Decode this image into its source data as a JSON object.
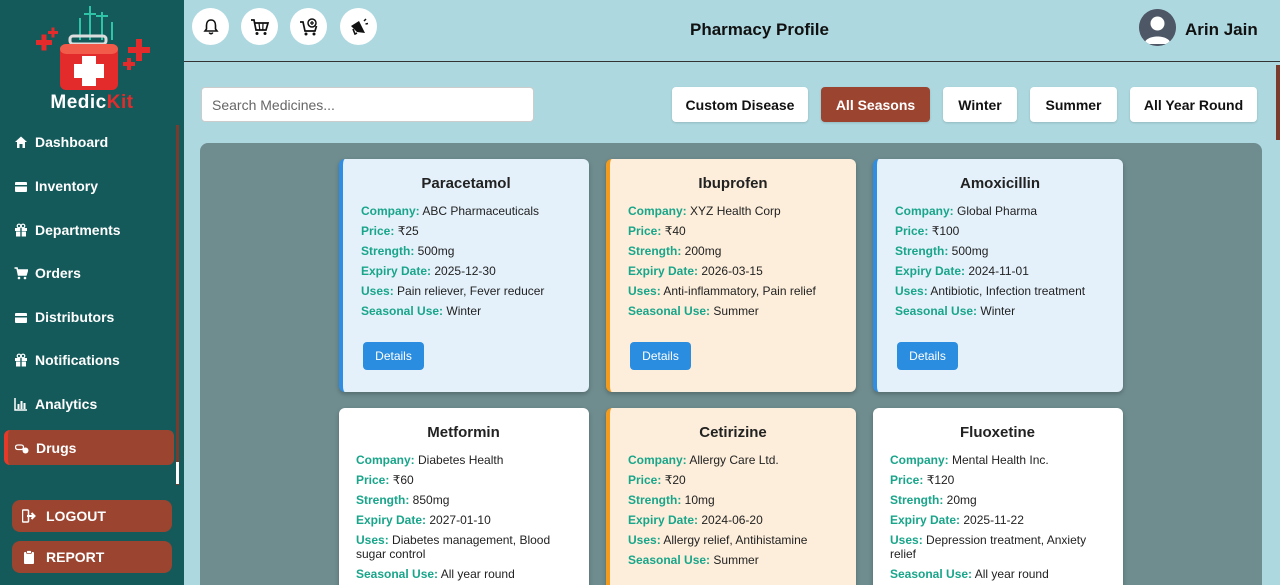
{
  "brand": {
    "name_part1": "Medic",
    "name_part2": "Kit"
  },
  "sidebar": {
    "items": [
      {
        "label": "Dashboard",
        "icon": "home-icon"
      },
      {
        "label": "Inventory",
        "icon": "box-icon"
      },
      {
        "label": "Departments",
        "icon": "gift-icon"
      },
      {
        "label": "Orders",
        "icon": "cart-icon"
      },
      {
        "label": "Distributors",
        "icon": "box-icon"
      },
      {
        "label": "Notifications",
        "icon": "gift-icon"
      },
      {
        "label": "Analytics",
        "icon": "chart-icon"
      },
      {
        "label": "Drugs",
        "icon": "pills-icon",
        "active": true
      }
    ],
    "logout_label": "LOGOUT",
    "report_label": "REPORT"
  },
  "header": {
    "title": "Pharmacy Profile",
    "user_name": "Arin Jain",
    "icons": [
      "bell-icon",
      "cart-icon",
      "cart-add-icon",
      "megaphone-icon"
    ]
  },
  "search": {
    "placeholder": "Search Medicines...",
    "value": ""
  },
  "filters": [
    {
      "label": "Custom Disease"
    },
    {
      "label": "All Seasons",
      "active": true
    },
    {
      "label": "Winter"
    },
    {
      "label": "Summer"
    },
    {
      "label": "All Year Round"
    }
  ],
  "field_labels": {
    "company": "Company:",
    "price": "Price:",
    "strength": "Strength:",
    "expiry": "Expiry Date:",
    "uses": "Uses:",
    "seasonal": "Seasonal Use:"
  },
  "details_label": "Details",
  "medicines": [
    {
      "name": "Paracetamol",
      "company": "ABC Pharmaceuticals",
      "price": "₹25",
      "strength": "500mg",
      "expiry": "2025-12-30",
      "uses": "Pain reliever, Fever reducer",
      "seasonal": "Winter"
    },
    {
      "name": "Ibuprofen",
      "company": "XYZ Health Corp",
      "price": "₹40",
      "strength": "200mg",
      "expiry": "2026-03-15",
      "uses": "Anti-inflammatory, Pain relief",
      "seasonal": "Summer"
    },
    {
      "name": "Amoxicillin",
      "company": "Global Pharma",
      "price": "₹100",
      "strength": "500mg",
      "expiry": "2024-11-01",
      "uses": "Antibiotic, Infection treatment",
      "seasonal": "Winter"
    },
    {
      "name": "Metformin",
      "company": "Diabetes Health",
      "price": "₹60",
      "strength": "850mg",
      "expiry": "2027-01-10",
      "uses": "Diabetes management, Blood sugar control",
      "seasonal": "All year round"
    },
    {
      "name": "Cetirizine",
      "company": "Allergy Care Ltd.",
      "price": "₹20",
      "strength": "10mg",
      "expiry": "2024-06-20",
      "uses": "Allergy relief, Antihistamine",
      "seasonal": "Summer"
    },
    {
      "name": "Fluoxetine",
      "company": "Mental Health Inc.",
      "price": "₹120",
      "strength": "20mg",
      "expiry": "2025-11-22",
      "uses": "Depression treatment, Anxiety relief",
      "seasonal": "All year round"
    }
  ]
}
